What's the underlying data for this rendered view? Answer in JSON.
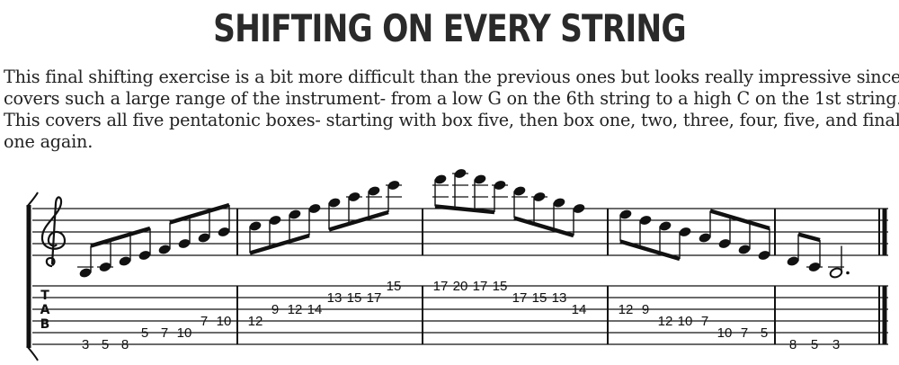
{
  "title": "SHIFTING ON EVERY STRING",
  "paragraph": {
    "lines": [
      "This final shifting exercise is a bit more difficult than the previous ones but looks really impressive since it",
      "covers such a large range of the instrument- from a low G on the 6th string to a high C on the 1st string.",
      "This covers all five pentatonic boxes- starting with box five, then box one, two, three, four, five, and finally",
      "one again."
    ]
  },
  "notation": {
    "tab_clef": [
      "T",
      "A",
      "B"
    ],
    "measures": [
      {
        "tab": [
          {
            "string": 6,
            "fret": "3"
          },
          {
            "string": 6,
            "fret": "5"
          },
          {
            "string": 6,
            "fret": "8"
          },
          {
            "string": 5,
            "fret": "5"
          },
          {
            "string": 5,
            "fret": "7"
          },
          {
            "string": 5,
            "fret": "10"
          },
          {
            "string": 4,
            "fret": "7"
          },
          {
            "string": 4,
            "fret": "10"
          }
        ],
        "pitch_steps": [
          -3,
          -2,
          -1,
          0,
          1,
          2,
          3,
          4
        ]
      },
      {
        "tab": [
          {
            "string": 4,
            "fret": "12"
          },
          {
            "string": 3,
            "fret": "9"
          },
          {
            "string": 3,
            "fret": "12"
          },
          {
            "string": 3,
            "fret": "14"
          },
          {
            "string": 2,
            "fret": "13"
          },
          {
            "string": 2,
            "fret": "15"
          },
          {
            "string": 2,
            "fret": "17"
          },
          {
            "string": 1,
            "fret": "15"
          }
        ],
        "pitch_steps": [
          5,
          6,
          7,
          8,
          9,
          10,
          11,
          12
        ]
      },
      {
        "tab": [
          {
            "string": 1,
            "fret": "17"
          },
          {
            "string": 1,
            "fret": "20"
          },
          {
            "string": 1,
            "fret": "17"
          },
          {
            "string": 1,
            "fret": "15"
          },
          {
            "string": 2,
            "fret": "17"
          },
          {
            "string": 2,
            "fret": "15"
          },
          {
            "string": 2,
            "fret": "13"
          },
          {
            "string": 3,
            "fret": "14"
          }
        ],
        "pitch_steps": [
          13,
          14,
          13,
          12,
          11,
          10,
          9,
          8
        ]
      },
      {
        "tab": [
          {
            "string": 3,
            "fret": "12"
          },
          {
            "string": 3,
            "fret": "9"
          },
          {
            "string": 4,
            "fret": "12"
          },
          {
            "string": 4,
            "fret": "10"
          },
          {
            "string": 4,
            "fret": "7"
          },
          {
            "string": 5,
            "fret": "10"
          },
          {
            "string": 5,
            "fret": "7"
          },
          {
            "string": 5,
            "fret": "5"
          }
        ],
        "pitch_steps": [
          7,
          6,
          5,
          4,
          3,
          2,
          1,
          0
        ]
      },
      {
        "tab": [
          {
            "string": 6,
            "fret": "8"
          },
          {
            "string": 6,
            "fret": "5"
          },
          {
            "string": 6,
            "fret": "3"
          }
        ],
        "pitch_steps": [
          -1,
          -2,
          -3
        ]
      }
    ]
  }
}
